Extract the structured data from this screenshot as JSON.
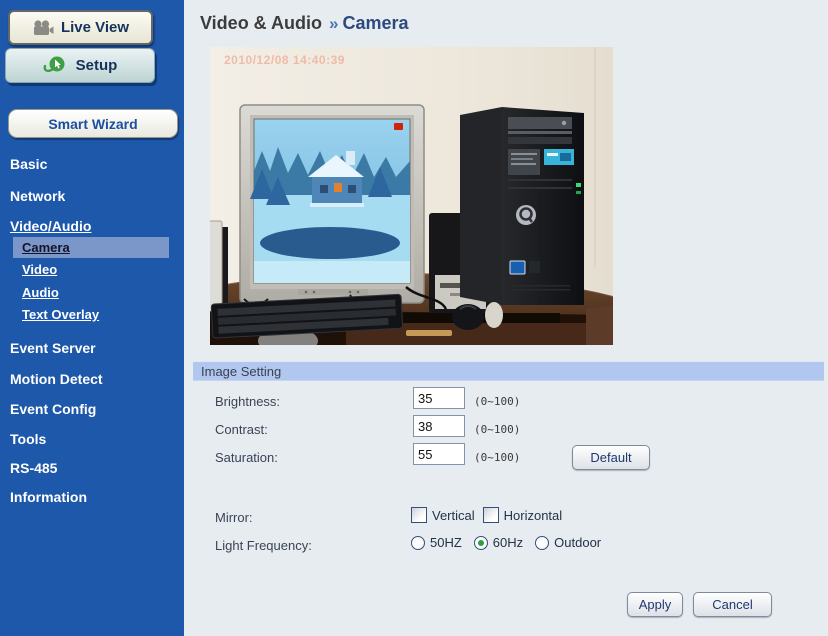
{
  "colors": {
    "sidebar_bg": "#1d58ab",
    "submenu_active_bg": "#7b96c8",
    "content_bg": "#e7ecf1",
    "section_bar_bg": "#b1c7ef",
    "header_accent": "#4a74b4",
    "radio_selected_dot": "#2f9e3f"
  },
  "sidebar": {
    "live_view_label": "Live View",
    "setup_label": "Setup",
    "smart_wizard_label": "Smart Wizard",
    "items": [
      {
        "label": "Basic"
      },
      {
        "label": "Network"
      },
      {
        "label": "Video/Audio",
        "active": true
      },
      {
        "label": "Camera",
        "sub": true,
        "active": true
      },
      {
        "label": "Video",
        "sub": true
      },
      {
        "label": "Audio",
        "sub": true
      },
      {
        "label": "Text Overlay",
        "sub": true
      },
      {
        "label": "Event Server"
      },
      {
        "label": "Motion Detect"
      },
      {
        "label": "Event Config"
      },
      {
        "label": "Tools"
      },
      {
        "label": "RS-485"
      },
      {
        "label": "Information"
      }
    ]
  },
  "header": {
    "section": "Video & Audio",
    "separator": "»",
    "page": "Camera"
  },
  "preview": {
    "timestamp": "2010/12/08 14:40:39"
  },
  "image_setting": {
    "title": "Image Setting",
    "fields": [
      {
        "label": "Brightness:",
        "value": "35",
        "range": "(0~100)"
      },
      {
        "label": "Contrast:",
        "value": "38",
        "range": "(0~100)"
      },
      {
        "label": "Saturation:",
        "value": "55",
        "range": "(0~100)"
      }
    ],
    "default_label": "Default",
    "mirror_label": "Mirror:",
    "mirror_options": [
      {
        "label": "Vertical",
        "checked": false
      },
      {
        "label": "Horizontal",
        "checked": false
      }
    ],
    "light_label": "Light Frequency:",
    "light_options": [
      {
        "label": "50HZ",
        "selected": false
      },
      {
        "label": "60Hz",
        "selected": true
      },
      {
        "label": "Outdoor",
        "selected": false
      }
    ]
  },
  "actions": {
    "apply_label": "Apply",
    "cancel_label": "Cancel"
  }
}
